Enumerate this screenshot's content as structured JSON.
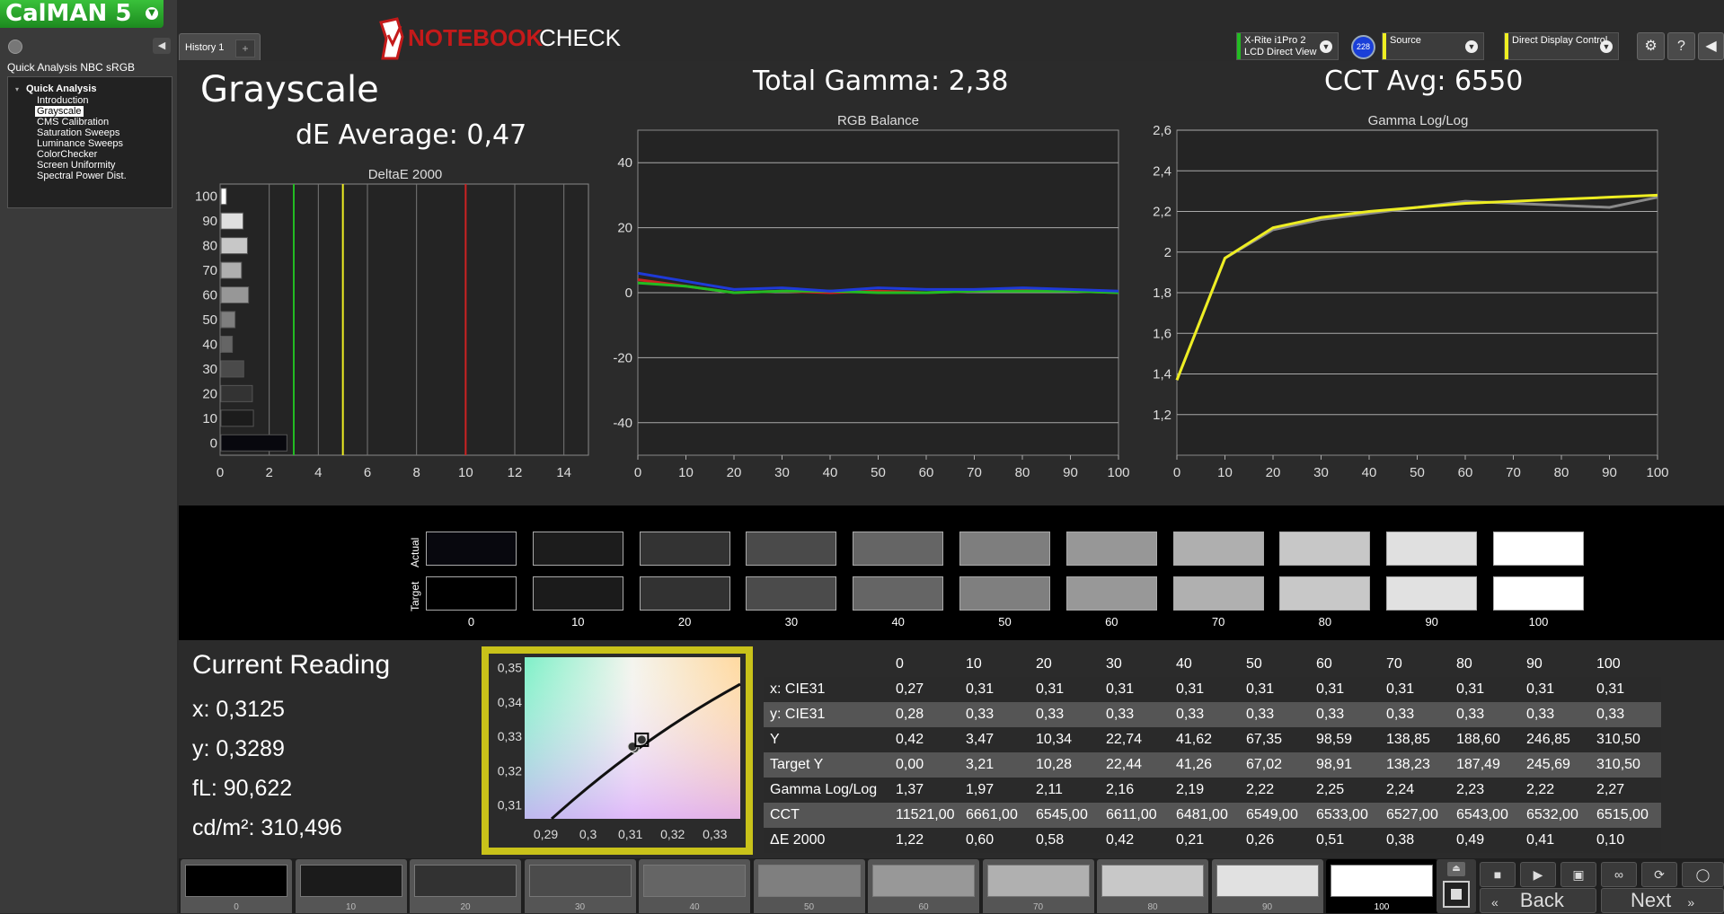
{
  "app": {
    "logo": "CalMAN 5",
    "session": "Quick Analysis NBC sRGB"
  },
  "nav": {
    "root": "Quick Analysis",
    "items": [
      "Introduction",
      "Grayscale",
      "CMS Calibration",
      "Saturation Sweeps",
      "Luminance Sweeps",
      "ColorChecker",
      "Screen Uniformity",
      "Spectral Power Dist."
    ],
    "selected_index": 1
  },
  "tabs": {
    "history": "History 1",
    "add": "+"
  },
  "watermark": {
    "text_a": "NOTEBOOK",
    "text_b": "CHECK"
  },
  "devices": {
    "meter_line1": "X-Rite i1Pro 2",
    "meter_line2": "LCD Direct View",
    "meter_badge": "228",
    "source": "Source",
    "display": "Direct Display Control"
  },
  "colors": {
    "green": "#22bb22",
    "yellow": "#eeee22",
    "blue": "#1e3ad8",
    "red": "#cc2222",
    "accent": "#c9c21a"
  },
  "page": {
    "title": "Grayscale",
    "de_average": "dE Average: 0,47",
    "total_gamma": "Total Gamma: 2,38",
    "cct_avg": "CCT Avg: 6550"
  },
  "chart_data": [
    {
      "type": "bar",
      "title": "DeltaE 2000",
      "orientation": "horizontal",
      "categories": [
        "0",
        "10",
        "20",
        "30",
        "40",
        "50",
        "60",
        "70",
        "80",
        "90",
        "100"
      ],
      "values": [
        1.22,
        0.6,
        0.58,
        0.42,
        0.21,
        0.26,
        0.51,
        0.38,
        0.49,
        0.41,
        0.1
      ],
      "xlim": [
        0,
        15
      ],
      "xticks": [
        "0",
        "2",
        "4",
        "6",
        "8",
        "10",
        "12",
        "14"
      ],
      "threshold_lines": [
        {
          "value": 3,
          "color": "green"
        },
        {
          "value": 5,
          "color": "yellow"
        },
        {
          "value": 10,
          "color": "red"
        }
      ]
    },
    {
      "type": "line",
      "title": "RGB Balance",
      "x": [
        0,
        10,
        20,
        30,
        40,
        50,
        60,
        70,
        80,
        90,
        100
      ],
      "ylim": [
        -50,
        50
      ],
      "yticks": [
        "40",
        "20",
        "0",
        "-20",
        "-40"
      ],
      "xticks": [
        "0",
        "10",
        "20",
        "30",
        "40",
        "50",
        "60",
        "70",
        "80",
        "90",
        "100"
      ],
      "series": [
        {
          "color": "red",
          "values": [
            4,
            2,
            0,
            0.5,
            0,
            0.5,
            0,
            0.5,
            1,
            0.5,
            0
          ]
        },
        {
          "color": "green",
          "values": [
            3,
            2,
            0,
            0.5,
            0.5,
            0,
            0,
            0.5,
            0.5,
            0.5,
            0
          ]
        },
        {
          "color": "blue",
          "values": [
            6,
            3.5,
            1,
            1.5,
            0.5,
            1.5,
            1,
            1,
            1.5,
            1,
            0.5
          ]
        }
      ]
    },
    {
      "type": "line",
      "title": "Gamma Log/Log",
      "x": [
        0,
        10,
        20,
        30,
        40,
        50,
        60,
        70,
        80,
        90,
        100
      ],
      "ylim": [
        1.0,
        2.6
      ],
      "yticks": [
        "2,6",
        "2,4",
        "2,2",
        "2",
        "1,8",
        "1,6",
        "1,4",
        "1,2"
      ],
      "xticks": [
        "0",
        "10",
        "20",
        "30",
        "40",
        "50",
        "60",
        "70",
        "80",
        "90",
        "100"
      ],
      "series": [
        {
          "color": "gray",
          "values": [
            1.37,
            1.97,
            2.11,
            2.16,
            2.19,
            2.22,
            2.25,
            2.24,
            2.23,
            2.22,
            2.27
          ]
        },
        {
          "color": "yellow",
          "values": [
            1.37,
            1.97,
            2.12,
            2.17,
            2.2,
            2.22,
            2.24,
            2.25,
            2.26,
            2.27,
            2.28
          ]
        }
      ]
    },
    {
      "type": "scatter",
      "title": "",
      "xticks": [
        "0,29",
        "0,3",
        "0,31",
        "0,32",
        "0,33"
      ],
      "yticks": [
        "0,35",
        "0,34",
        "0,33",
        "0,32",
        "0,31"
      ],
      "xlim": [
        0.285,
        0.336
      ],
      "ylim": [
        0.306,
        0.353
      ],
      "points": [
        {
          "x": 0.3125,
          "y": 0.3289
        },
        {
          "x": 0.311,
          "y": 0.3265
        },
        {
          "x": 0.3105,
          "y": 0.327
        },
        {
          "x": 0.3127,
          "y": 0.329
        }
      ],
      "target": {
        "x": 0.3127,
        "y": 0.329
      }
    }
  ],
  "swatches": {
    "actual_label": "Actual",
    "target_label": "Target",
    "labels": [
      "0",
      "10",
      "20",
      "30",
      "40",
      "50",
      "60",
      "70",
      "80",
      "90",
      "100"
    ],
    "actual_colors": [
      "#08080e",
      "#1c1c1c",
      "#333333",
      "#4a4a4a",
      "#656565",
      "#7e7e7e",
      "#979797",
      "#afafaf",
      "#c7c7c7",
      "#e0e0e0",
      "#ffffff"
    ],
    "target_colors": [
      "#000000",
      "#1b1b1b",
      "#323232",
      "#4b4b4b",
      "#656565",
      "#7f7f7f",
      "#989898",
      "#b0b0b0",
      "#c8c8c8",
      "#e1e1e1",
      "#ffffff"
    ]
  },
  "current": {
    "title": "Current Reading",
    "x": "x: 0,3125",
    "y": "y: 0,3289",
    "fL": "fL: 90,622",
    "cdm2": "cd/m²: 310,496"
  },
  "table": {
    "headers": [
      "",
      "0",
      "10",
      "20",
      "30",
      "40",
      "50",
      "60",
      "70",
      "80",
      "90",
      "100"
    ],
    "rows": [
      {
        "label": "x: CIE31",
        "values": [
          "0,27",
          "0,31",
          "0,31",
          "0,31",
          "0,31",
          "0,31",
          "0,31",
          "0,31",
          "0,31",
          "0,31",
          "0,31"
        ]
      },
      {
        "label": "y: CIE31",
        "values": [
          "0,28",
          "0,33",
          "0,33",
          "0,33",
          "0,33",
          "0,33",
          "0,33",
          "0,33",
          "0,33",
          "0,33",
          "0,33"
        ]
      },
      {
        "label": "Y",
        "values": [
          "0,42",
          "3,47",
          "10,34",
          "22,74",
          "41,62",
          "67,35",
          "98,59",
          "138,85",
          "188,60",
          "246,85",
          "310,50"
        ]
      },
      {
        "label": "Target Y",
        "values": [
          "0,00",
          "3,21",
          "10,28",
          "22,44",
          "41,26",
          "67,02",
          "98,91",
          "138,23",
          "187,49",
          "245,69",
          "310,50"
        ]
      },
      {
        "label": "Gamma Log/Log",
        "values": [
          "1,37",
          "1,97",
          "2,11",
          "2,16",
          "2,19",
          "2,22",
          "2,25",
          "2,24",
          "2,23",
          "2,22",
          "2,27"
        ]
      },
      {
        "label": "CCT",
        "values": [
          "11521,00",
          "6661,00",
          "6545,00",
          "6611,00",
          "6481,00",
          "6549,00",
          "6533,00",
          "6527,00",
          "6543,00",
          "6532,00",
          "6515,00"
        ]
      },
      {
        "label": "ΔE 2000",
        "values": [
          "1,22",
          "0,60",
          "0,58",
          "0,42",
          "0,21",
          "0,26",
          "0,51",
          "0,38",
          "0,49",
          "0,41",
          "0,10"
        ]
      }
    ]
  },
  "bottom_swatches": {
    "labels": [
      "0",
      "10",
      "20",
      "30",
      "40",
      "50",
      "60",
      "70",
      "80",
      "90",
      "100"
    ],
    "colors": [
      "#000000",
      "#1b1b1b",
      "#323232",
      "#4b4b4b",
      "#656565",
      "#7f7f7f",
      "#989898",
      "#b0b0b0",
      "#c8c8c8",
      "#e1e1e1",
      "#ffffff"
    ],
    "selected_index": 10
  },
  "controls": {
    "back": "Back",
    "next": "Next"
  }
}
